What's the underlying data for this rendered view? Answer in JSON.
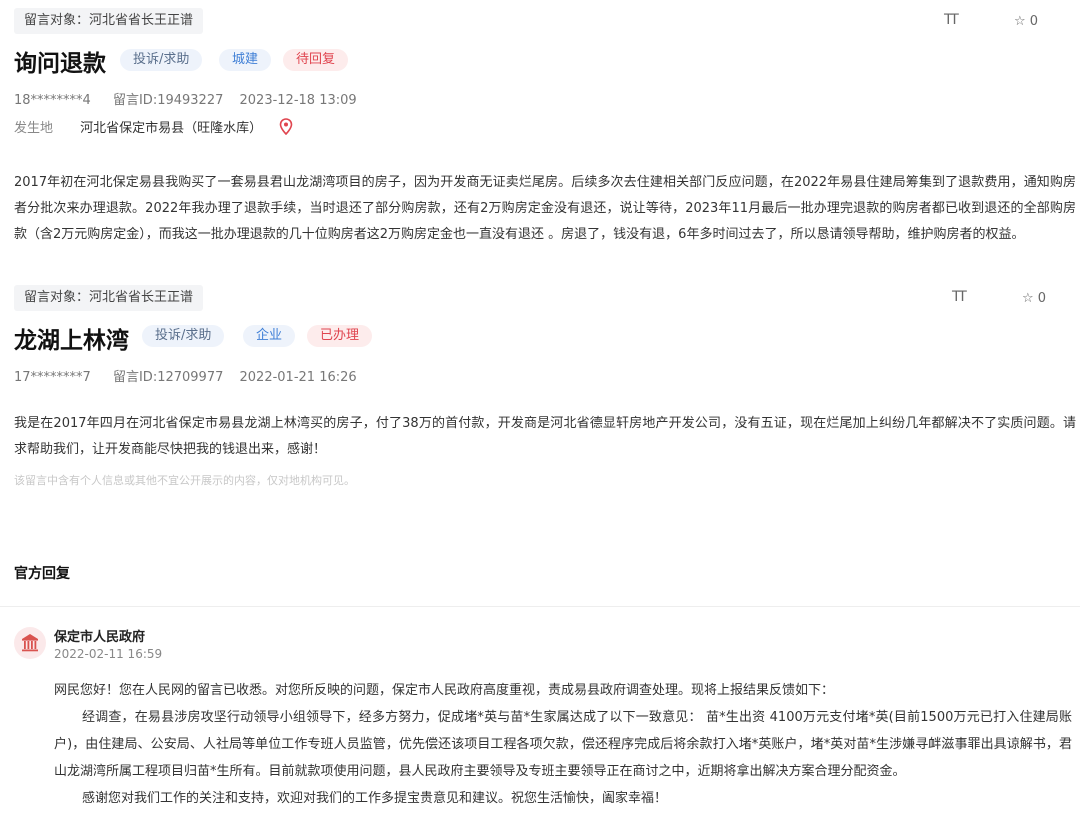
{
  "message1": {
    "target": "留言对象：河北省省长王正谱",
    "title": "询问退款",
    "tags": [
      "投诉/求助",
      "城建",
      "待回复"
    ],
    "user": "18********4",
    "msg_id": "留言ID:19493227",
    "datetime": "2023-12-18 13:09",
    "location_label": "发生地",
    "location": "河北省保定市易县（旺隆水库）",
    "font_toggle": "TT",
    "favorite_count": "0",
    "body": "2017年初在河北保定易县我购买了一套易县君山龙湖湾项目的房子，因为开发商无证卖烂尾房。后续多次去住建相关部门反应问题，在2022年易县住建局筹集到了退款费用，通知购房者分批次来办理退款。2022年我办理了退款手续，当时退还了部分购房款，还有2万购房定金没有退还，说让等待，2023年11月最后一批办理完退款的购房者都已收到退还的全部购房款（含2万元购房定金），而我这一批办理退款的几十位购房者这2万购房定金也一直没有退还 。房退了，钱没有退，6年多时间过去了，所以恳请领导帮助，维护购房者的权益。"
  },
  "message2": {
    "target": "留言对象：河北省省长王正谱",
    "title": "龙湖上林湾",
    "tags": [
      "投诉/求助",
      "企业",
      "已办理"
    ],
    "user": "17********7",
    "msg_id": "留言ID:12709977",
    "datetime": "2022-01-21 16:26",
    "font_toggle": "TT",
    "favorite_count": "0",
    "body": "我是在2017年四月在河北省保定市易县龙湖上林湾买的房子，付了38万的首付款，开发商是河北省德显轩房地产开发公司，没有五证，现在烂尾加上纠纷几年都解决不了实质问题。请求帮助我们，让开发商能尽快把我的钱退出来，感谢！",
    "privacy_note": "该留言中含有个人信息或其他不宜公开展示的内容，仅对地机构可见。"
  },
  "official_reply": {
    "section_title": "官方回复",
    "org": "保定市人民政府",
    "datetime": "2022-02-11 16:59",
    "p1": "网民您好！您在人民网的留言已收悉。对您所反映的问题，保定市人民政府高度重视，责成易县政府调查处理。现将上报结果反馈如下：",
    "p2": "经调查，在易县涉房攻坚行动领导小组领导下，经多方努力，促成堵*英与苗*生家属达成了以下一致意见：  苗*生出资 4100万元支付堵*英(目前1500万元已打入住建局账户)，由住建局、公安局、人社局等单位工作专班人员监管，优先偿还该项目工程各项欠款，偿还程序完成后将余款打入堵*英账户，堵*英对苗*生涉嫌寻衅滋事罪出具谅解书，君山龙湖湾所属工程项目归苗*生所有。目前就款项使用问题，县人民政府主要领导及专班主要领导正在商讨之中，近期将拿出解决方案合理分配资金。",
    "p3": "感谢您对我们工作的关注和支持，欢迎对我们的工作多提宝贵意见和建议。祝您生活愉快，阖家幸福！"
  },
  "colors": {
    "pending": "#e0454f",
    "done": "#e0454f",
    "field": "#3f7fd6",
    "location_pin": "#e0454f"
  }
}
